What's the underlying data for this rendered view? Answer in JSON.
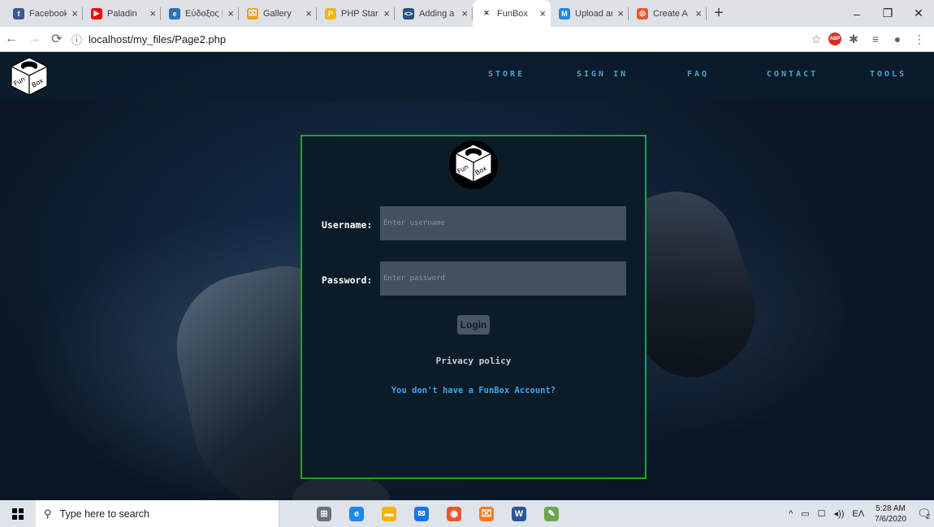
{
  "browser": {
    "tabs": [
      {
        "title": "Facebook",
        "icon": "facebook-icon",
        "color": "#3b5998",
        "glyph": "f",
        "active": false
      },
      {
        "title": "Paladin",
        "icon": "youtube-icon",
        "color": "#ff0000",
        "glyph": "▶",
        "active": false
      },
      {
        "title": "Εύδοξος | Ε",
        "icon": "eudoxus-icon",
        "color": "#2c6fb5",
        "glyph": "e",
        "active": false
      },
      {
        "title": "Gallery",
        "icon": "gallery-icon",
        "color": "#f0a20a",
        "glyph": "⌧",
        "active": false
      },
      {
        "title": "PHP Star Ra",
        "icon": "php-icon",
        "color": "#f0b90b",
        "glyph": "P",
        "active": false
      },
      {
        "title": "Adding a G",
        "icon": "code-icon",
        "color": "#2f4f7f",
        "glyph": "<>",
        "active": false
      },
      {
        "title": "FunBox",
        "icon": "funbox-tab-icon",
        "color": "#333333",
        "glyph": "✕",
        "active": true
      },
      {
        "title": "Upload and",
        "icon": "m-icon",
        "color": "#1e88e5",
        "glyph": "M",
        "active": false
      },
      {
        "title": "Create A Si",
        "icon": "create-icon",
        "color": "#e8572c",
        "glyph": "◎",
        "active": false
      }
    ],
    "close_glyph": "×",
    "new_tab_glyph": "+",
    "window_controls": [
      "–",
      "❐",
      "✕"
    ],
    "url": "localhost/my_files/Page2.php",
    "toolbar_icons": [
      "☆",
      "ABP",
      "✱",
      "≡",
      "●",
      "⋮"
    ]
  },
  "nav": {
    "links": [
      "STORE",
      "SIGN IN",
      "FAQ",
      "CONTACT",
      "TOOLS"
    ]
  },
  "login": {
    "username_label": "Username:",
    "username_placeholder": "Enter username",
    "password_label": "Password:",
    "password_placeholder": "Enter password",
    "login_button": "Login",
    "privacy_link": "Privacy policy",
    "account_link": "You don't have a FunBox Account?"
  },
  "logo_text": {
    "fun": "Fun",
    "box": "Box"
  },
  "taskbar": {
    "search_placeholder": "Type here to search",
    "apps": [
      {
        "name": "task-view-icon",
        "color": "#6b7280",
        "glyph": "⊞"
      },
      {
        "name": "edge-icon",
        "color": "#1e88e5",
        "glyph": "e"
      },
      {
        "name": "file-explorer-icon",
        "color": "#f4b400",
        "glyph": "▬"
      },
      {
        "name": "mail-icon",
        "color": "#1a73e8",
        "glyph": "✉"
      },
      {
        "name": "chrome-icon",
        "color": "#e8572c",
        "glyph": "◉"
      },
      {
        "name": "xampp-icon",
        "color": "#fb7a24",
        "glyph": "⌧"
      },
      {
        "name": "word-icon",
        "color": "#2b579a",
        "glyph": "W"
      },
      {
        "name": "paint-icon",
        "color": "#6aa84f",
        "glyph": "✎"
      }
    ],
    "tray_symbols": [
      "^",
      "▭",
      "☐",
      "◂))"
    ],
    "language": "ΕΛ",
    "time": "5:28 AM",
    "date": "7/6/2020",
    "notification_count": "2"
  },
  "colors": {
    "panel_border": "#1fa71f",
    "nav_link": "#4aa3c7",
    "account_link": "#3ea6ee"
  }
}
